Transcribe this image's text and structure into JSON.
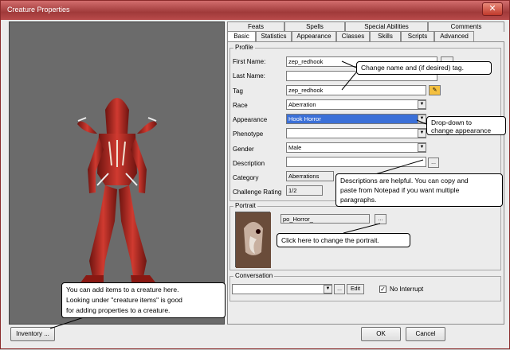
{
  "window": {
    "title": "Creature Properties",
    "close_label": "✕"
  },
  "tabs": {
    "row1": [
      {
        "label": "Feats"
      },
      {
        "label": "Spells"
      },
      {
        "label": "Special Abilities"
      },
      {
        "label": "Comments"
      }
    ],
    "row2": [
      {
        "label": "Basic"
      },
      {
        "label": "Statistics"
      },
      {
        "label": "Appearance"
      },
      {
        "label": "Classes"
      },
      {
        "label": "Skills"
      },
      {
        "label": "Scripts"
      },
      {
        "label": "Advanced"
      }
    ]
  },
  "profile": {
    "title": "Profile",
    "first_name_label": "First Name:",
    "first_name_value": "zep_redhook",
    "last_name_label": "Last Name:",
    "last_name_value": "",
    "tag_label": "Tag",
    "tag_value": "zep_redhook",
    "race_label": "Race",
    "race_value": "Aberration",
    "appearance_label": "Appearance",
    "appearance_value": "Hook Horror",
    "phenotype_label": "Phenotype",
    "phenotype_value": "",
    "gender_label": "Gender",
    "gender_value": "Male",
    "description_label": "Description",
    "description_value": "",
    "description_btn": "...",
    "category_label": "Category",
    "category_value": "Aberrations",
    "challenge_label": "Challenge Rating",
    "challenge_value": "1/2"
  },
  "portrait": {
    "title": "Portrait",
    "value": "po_Horror_",
    "browse_btn": "..."
  },
  "conversation": {
    "title": "Conversation",
    "value": "",
    "browse_btn": "...",
    "edit_btn": "Edit",
    "no_interrupt_label": "No Interrupt",
    "no_interrupt_checked": "✓"
  },
  "buttons": {
    "inventory": "Inventory ...",
    "ok": "OK",
    "cancel": "Cancel"
  },
  "callouts": {
    "name_tag": "Change name and (if desired) tag.",
    "appearance": [
      "Drop-down to",
      "change appearance"
    ],
    "description": [
      "Descriptions are helpful. You can copy and",
      "paste from Notepad if you want multiple",
      "paragraphs."
    ],
    "portrait": "Click here to change the portrait.",
    "inventory": [
      "You can add items to a creature here.",
      "Looking under \"creature items\" is good",
      "for adding properties to a creature."
    ]
  },
  "colors": {
    "title_bar": "#a03a3a",
    "selection": "#3b70d8",
    "creature": "#b8302a"
  }
}
